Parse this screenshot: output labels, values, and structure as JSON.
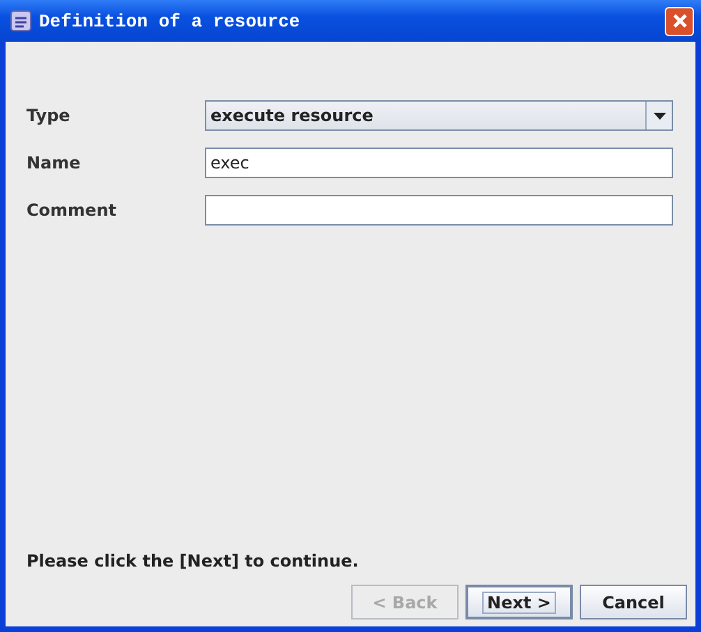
{
  "window": {
    "title": "Definition of a resource"
  },
  "fields": [
    {
      "kind": "combo",
      "label": "Type",
      "value": "execute resource"
    },
    {
      "kind": "text",
      "label": "Name",
      "value": "exec"
    },
    {
      "kind": "text",
      "label": "Comment"
    }
  ],
  "message": "Please click the [Next] to continue.",
  "buttons": [
    {
      "label": "< Back",
      "disabled": true,
      "focused": false
    },
    {
      "label": "Next >",
      "disabled": false,
      "focused": true
    },
    {
      "label": "Cancel",
      "disabled": false,
      "focused": false
    }
  ]
}
